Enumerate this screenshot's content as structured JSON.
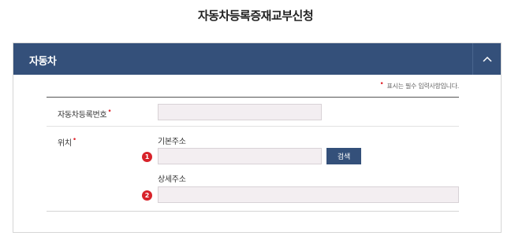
{
  "page": {
    "title": "자동차등록증재교부신청"
  },
  "section": {
    "title": "자동차",
    "collapse_icon": "chevron-up-icon",
    "required_note": "표시는 필수 입력사항입니다."
  },
  "form": {
    "registration_number": {
      "label": "자동차등록번호",
      "required": true,
      "value": ""
    },
    "location": {
      "label": "위치",
      "required": true,
      "basic_address": {
        "label": "기본주소",
        "badge": "1",
        "value": ""
      },
      "search_button": "검색",
      "detail_address": {
        "label": "상세주소",
        "badge": "2",
        "value": ""
      }
    }
  },
  "colors": {
    "header": "#34507a",
    "required": "#e0232b",
    "input_bg": "#f3eef1",
    "badge": "#d8232a"
  }
}
